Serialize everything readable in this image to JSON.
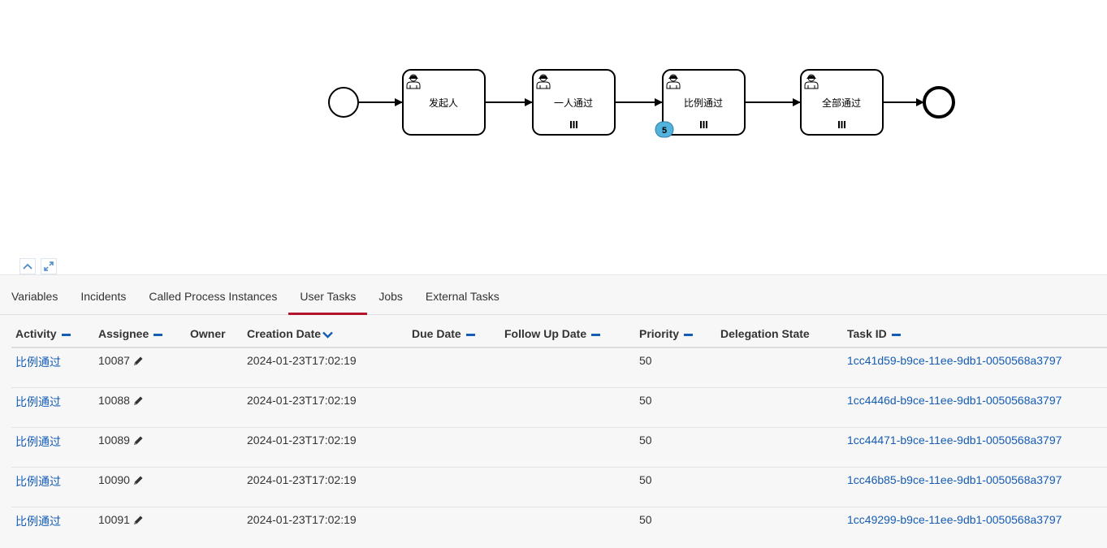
{
  "diagram": {
    "tasks": [
      {
        "label": "发起人",
        "multi": false
      },
      {
        "label": "一人通过",
        "multi": true
      },
      {
        "label": "比例通过",
        "multi": true,
        "badge": "5"
      },
      {
        "label": "全部通过",
        "multi": true
      }
    ]
  },
  "tabs": [
    {
      "label": "Variables",
      "active": false
    },
    {
      "label": "Incidents",
      "active": false
    },
    {
      "label": "Called Process Instances",
      "active": false
    },
    {
      "label": "User Tasks",
      "active": true
    },
    {
      "label": "Jobs",
      "active": false
    },
    {
      "label": "External Tasks",
      "active": false
    }
  ],
  "table": {
    "headers": {
      "activity": "Activity",
      "assignee": "Assignee",
      "owner": "Owner",
      "creation_date": "Creation Date",
      "due_date": "Due Date",
      "follow_up_date": "Follow Up Date",
      "priority": "Priority",
      "delegation_state": "Delegation State",
      "task_id": "Task ID"
    },
    "rows": [
      {
        "activity": "比例通过",
        "assignee": "10087",
        "owner": "",
        "creation_date": "2024-01-23T17:02:19",
        "due_date": "",
        "follow_up_date": "",
        "priority": "50",
        "delegation_state": "",
        "task_id": "1cc41d59-b9ce-11ee-9db1-0050568a3797"
      },
      {
        "activity": "比例通过",
        "assignee": "10088",
        "owner": "",
        "creation_date": "2024-01-23T17:02:19",
        "due_date": "",
        "follow_up_date": "",
        "priority": "50",
        "delegation_state": "",
        "task_id": "1cc4446d-b9ce-11ee-9db1-0050568a3797"
      },
      {
        "activity": "比例通过",
        "assignee": "10089",
        "owner": "",
        "creation_date": "2024-01-23T17:02:19",
        "due_date": "",
        "follow_up_date": "",
        "priority": "50",
        "delegation_state": "",
        "task_id": "1cc44471-b9ce-11ee-9db1-0050568a3797"
      },
      {
        "activity": "比例通过",
        "assignee": "10090",
        "owner": "",
        "creation_date": "2024-01-23T17:02:19",
        "due_date": "",
        "follow_up_date": "",
        "priority": "50",
        "delegation_state": "",
        "task_id": "1cc46b85-b9ce-11ee-9db1-0050568a3797"
      },
      {
        "activity": "比例通过",
        "assignee": "10091",
        "owner": "",
        "creation_date": "2024-01-23T17:02:19",
        "due_date": "",
        "follow_up_date": "",
        "priority": "50",
        "delegation_state": "",
        "task_id": "1cc49299-b9ce-11ee-9db1-0050568a3797"
      }
    ]
  },
  "colors": {
    "link": "#155cb5",
    "active_tab": "#b5152b",
    "badge": "#52b3dc"
  },
  "icons": {
    "collapse": "chevron-up-icon",
    "fullscreen": "expand-icon",
    "edit": "pencil-icon",
    "user_task": "user-icon",
    "multi_instance": "parallel-marker-icon"
  }
}
